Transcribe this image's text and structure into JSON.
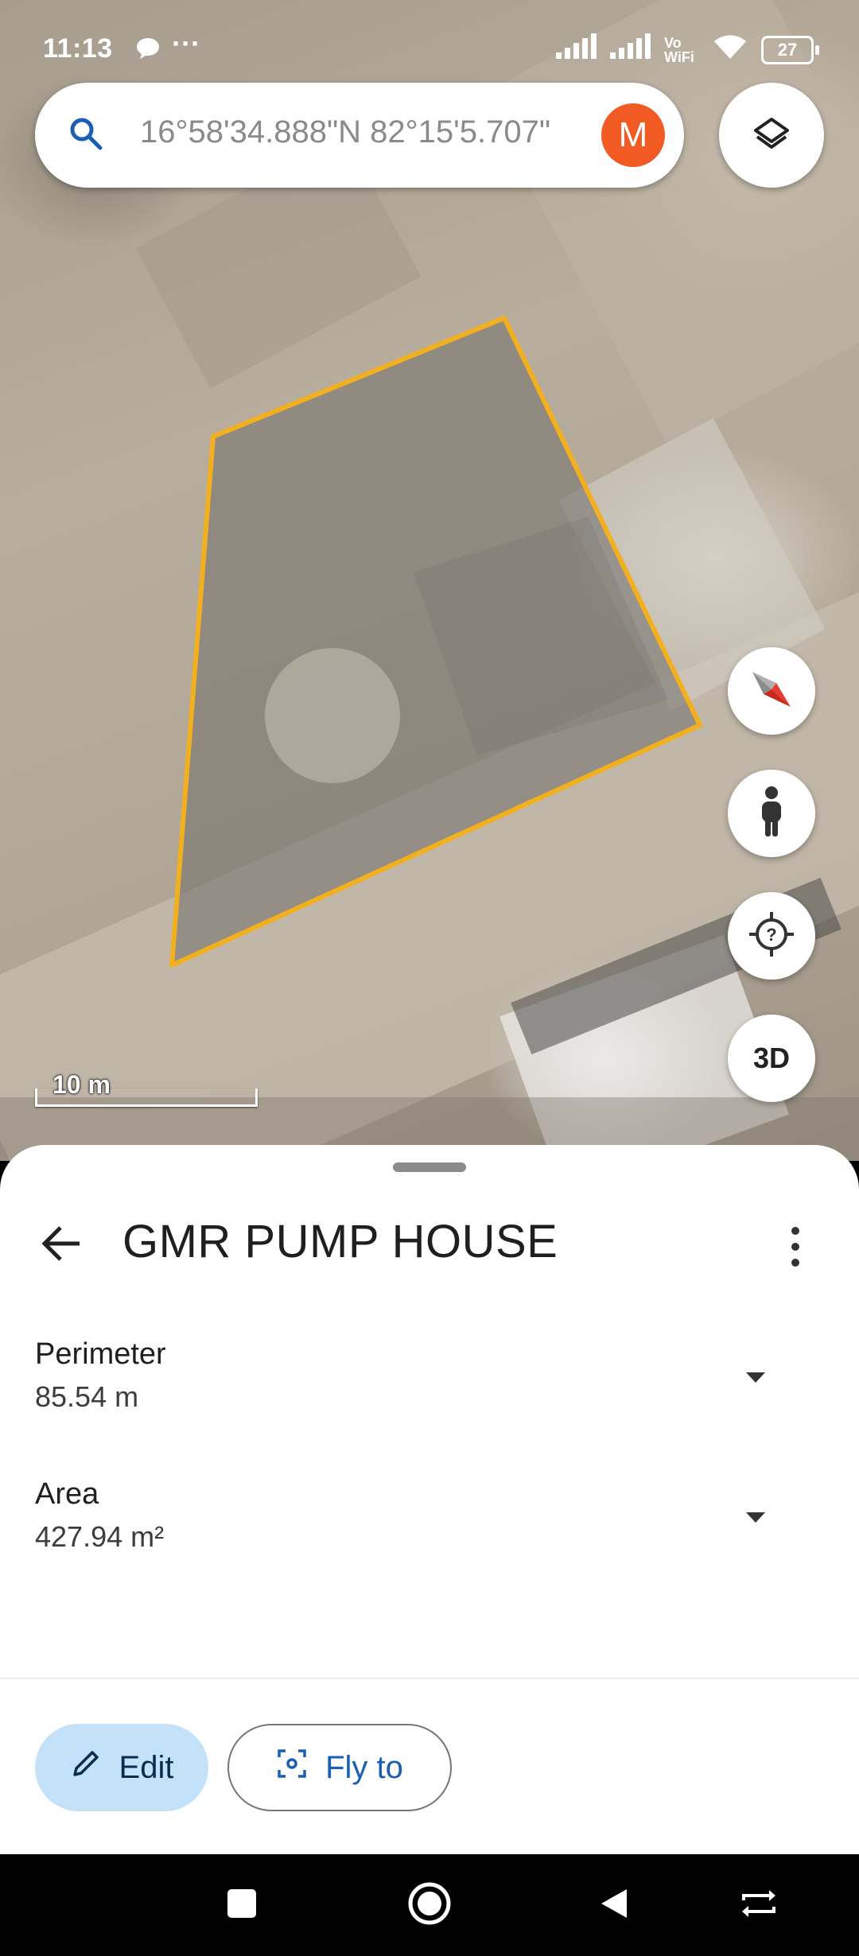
{
  "status_bar": {
    "time": "11:13",
    "overflow": "···",
    "volte_label": "Vo WiFi",
    "battery": "27"
  },
  "search": {
    "value": "16°58'34.888\"N 82°15'5.707\"",
    "avatar_letter": "M"
  },
  "map": {
    "scale_label": "10 m",
    "threed_label": "3D",
    "polygon_color": "#f2b01e"
  },
  "sheet": {
    "title": "GMR PUMP HOUSE",
    "perimeter_label": "Perimeter",
    "perimeter_value": "85.54 m",
    "area_label": "Area",
    "area_value": "427.94 m²",
    "edit_label": "Edit",
    "flyto_label": "Fly to"
  },
  "colors": {
    "accent_blue": "#1a5fb4",
    "edit_bg": "#c3e2fa",
    "avatar_bg": "#f25a24"
  }
}
